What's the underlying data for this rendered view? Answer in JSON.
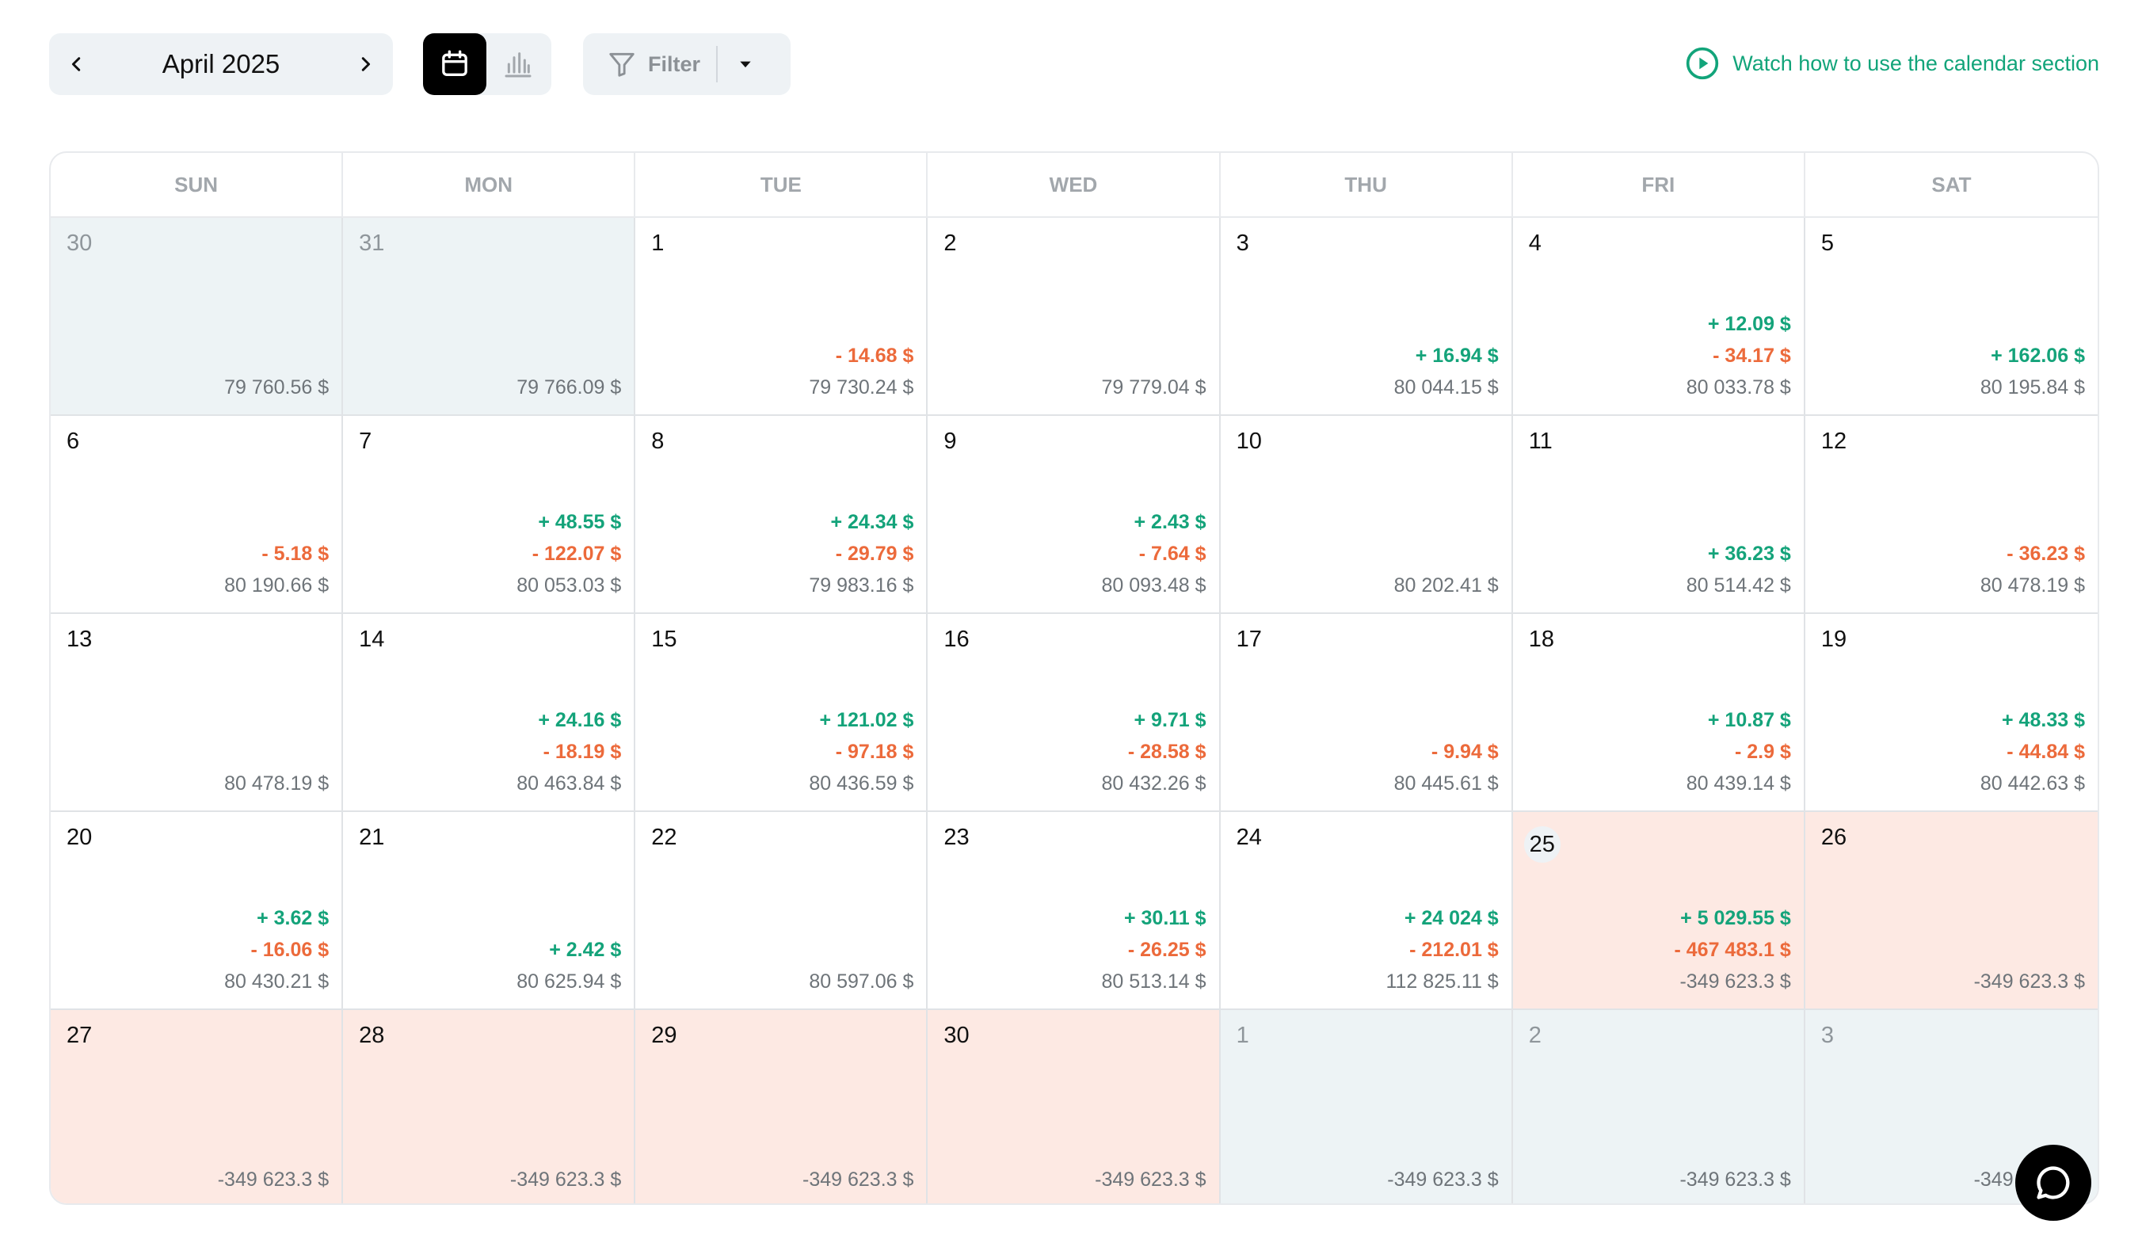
{
  "toolbar": {
    "month": "April 2025",
    "prev_icon": "chevron-left-icon",
    "next_icon": "chevron-right-icon",
    "calendar_view_icon": "calendar-icon",
    "chart_view_icon": "bar-chart-icon",
    "filter_label": "Filter",
    "filter_icon": "funnel-icon",
    "filter_caret_icon": "caret-down-icon",
    "watch_label": "Watch how to use the calendar section",
    "watch_icon": "play-circle-icon",
    "accent_color": "#12a47a"
  },
  "weekdays": [
    "SUN",
    "MON",
    "TUE",
    "WED",
    "THU",
    "FRI",
    "SAT"
  ],
  "days": [
    {
      "day": "30",
      "state": "outside",
      "plus": "",
      "minus": "",
      "balance": "79 760.56 $"
    },
    {
      "day": "31",
      "state": "outside",
      "plus": "",
      "minus": "",
      "balance": "79 766.09 $"
    },
    {
      "day": "1",
      "state": "normal",
      "plus": "",
      "minus": "- 14.68 $",
      "balance": "79 730.24 $"
    },
    {
      "day": "2",
      "state": "normal",
      "plus": "",
      "minus": "",
      "balance": "79 779.04 $"
    },
    {
      "day": "3",
      "state": "normal",
      "plus": "+ 16.94 $",
      "minus": "",
      "balance": "80 044.15 $"
    },
    {
      "day": "4",
      "state": "normal",
      "plus": "+ 12.09 $",
      "minus": "- 34.17 $",
      "balance": "80 033.78 $"
    },
    {
      "day": "5",
      "state": "normal",
      "plus": "+ 162.06 $",
      "minus": "",
      "balance": "80 195.84 $"
    },
    {
      "day": "6",
      "state": "normal",
      "plus": "",
      "minus": "- 5.18 $",
      "balance": "80 190.66 $"
    },
    {
      "day": "7",
      "state": "normal",
      "plus": "+ 48.55 $",
      "minus": "- 122.07 $",
      "balance": "80 053.03 $"
    },
    {
      "day": "8",
      "state": "normal",
      "plus": "+ 24.34 $",
      "minus": "- 29.79 $",
      "balance": "79 983.16 $"
    },
    {
      "day": "9",
      "state": "normal",
      "plus": "+ 2.43 $",
      "minus": "- 7.64 $",
      "balance": "80 093.48 $"
    },
    {
      "day": "10",
      "state": "normal",
      "plus": "",
      "minus": "",
      "balance": "80 202.41 $"
    },
    {
      "day": "11",
      "state": "normal",
      "plus": "+ 36.23 $",
      "minus": "",
      "balance": "80 514.42 $"
    },
    {
      "day": "12",
      "state": "normal",
      "plus": "",
      "minus": "- 36.23 $",
      "balance": "80 478.19 $"
    },
    {
      "day": "13",
      "state": "normal",
      "plus": "",
      "minus": "",
      "balance": "80 478.19 $"
    },
    {
      "day": "14",
      "state": "normal",
      "plus": "+ 24.16 $",
      "minus": "- 18.19 $",
      "balance": "80 463.84 $"
    },
    {
      "day": "15",
      "state": "normal",
      "plus": "+ 121.02 $",
      "minus": "- 97.18 $",
      "balance": "80 436.59 $"
    },
    {
      "day": "16",
      "state": "normal",
      "plus": "+ 9.71 $",
      "minus": "- 28.58 $",
      "balance": "80 432.26 $"
    },
    {
      "day": "17",
      "state": "normal",
      "plus": "",
      "minus": "- 9.94 $",
      "balance": "80 445.61 $"
    },
    {
      "day": "18",
      "state": "normal",
      "plus": "+ 10.87 $",
      "minus": "- 2.9 $",
      "balance": "80 439.14 $"
    },
    {
      "day": "19",
      "state": "normal",
      "plus": "+ 48.33 $",
      "minus": "- 44.84 $",
      "balance": "80 442.63 $"
    },
    {
      "day": "20",
      "state": "normal",
      "plus": "+ 3.62 $",
      "minus": "- 16.06 $",
      "balance": "80 430.21 $"
    },
    {
      "day": "21",
      "state": "normal",
      "plus": "",
      "minus": "+ 2.42 $",
      "balance": "80 625.94 $"
    },
    {
      "day": "22",
      "state": "normal",
      "plus": "",
      "minus": "",
      "balance": "80 597.06 $"
    },
    {
      "day": "23",
      "state": "normal",
      "plus": "+ 30.11 $",
      "minus": "- 26.25 $",
      "balance": "80 513.14 $"
    },
    {
      "day": "24",
      "state": "normal",
      "plus": "+ 24 024 $",
      "minus": "- 212.01 $",
      "balance": "112 825.11 $"
    },
    {
      "day": "25",
      "state": "today-neg",
      "plus": "+ 5 029.55 $",
      "minus": "- 467 483.1 $",
      "balance": "-349 623.3 $"
    },
    {
      "day": "26",
      "state": "neg",
      "plus": "",
      "minus": "",
      "balance": "-349 623.3 $"
    },
    {
      "day": "27",
      "state": "neg",
      "plus": "",
      "minus": "",
      "balance": "-349 623.3 $"
    },
    {
      "day": "28",
      "state": "neg",
      "plus": "",
      "minus": "",
      "balance": "-349 623.3 $"
    },
    {
      "day": "29",
      "state": "neg",
      "plus": "",
      "minus": "",
      "balance": "-349 623.3 $"
    },
    {
      "day": "30",
      "state": "neg",
      "plus": "",
      "minus": "",
      "balance": "-349 623.3 $"
    },
    {
      "day": "1",
      "state": "outside",
      "plus": "",
      "minus": "",
      "balance": "-349 623.3 $"
    },
    {
      "day": "2",
      "state": "outside",
      "plus": "",
      "minus": "",
      "balance": "-349 623.3 $"
    },
    {
      "day": "3",
      "state": "outside",
      "plus": "",
      "minus": "",
      "balance": "-349 623.3 $"
    }
  ],
  "chat": {
    "icon": "chat-bubble-icon"
  }
}
